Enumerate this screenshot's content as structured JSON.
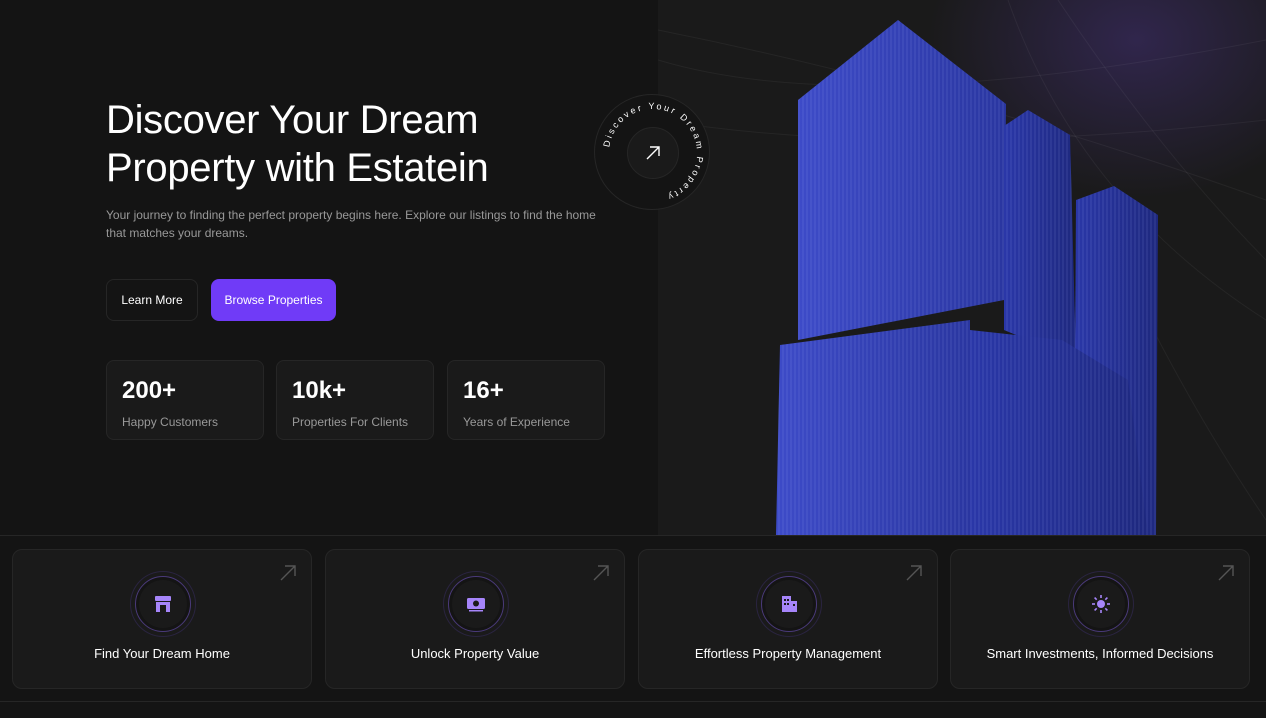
{
  "hero": {
    "title": "Discover Your Dream Property with Estatein",
    "description": "Your journey to finding the perfect property begins here. Explore our listings to find the home that matches your dreams.",
    "learn_more_label": "Learn More",
    "browse_label": "Browse Properties",
    "badge_text": "Discover Your Dream Property",
    "stats": [
      {
        "value": "200+",
        "label": "Happy Customers"
      },
      {
        "value": "10k+",
        "label": "Properties For Clients"
      },
      {
        "value": "16+",
        "label": "Years of Experience"
      }
    ]
  },
  "services": [
    {
      "title": "Find Your Dream Home",
      "icon": "storefront-icon"
    },
    {
      "title": "Unlock Property Value",
      "icon": "money-icon"
    },
    {
      "title": "Effortless Property Management",
      "icon": "building-icon"
    },
    {
      "title": "Smart Investments, Informed Decisions",
      "icon": "sun-icon"
    }
  ],
  "colors": {
    "accent": "#703bf7",
    "background": "#141414",
    "surface": "#1a1a1a",
    "border": "#262626",
    "muted_text": "#999999"
  }
}
